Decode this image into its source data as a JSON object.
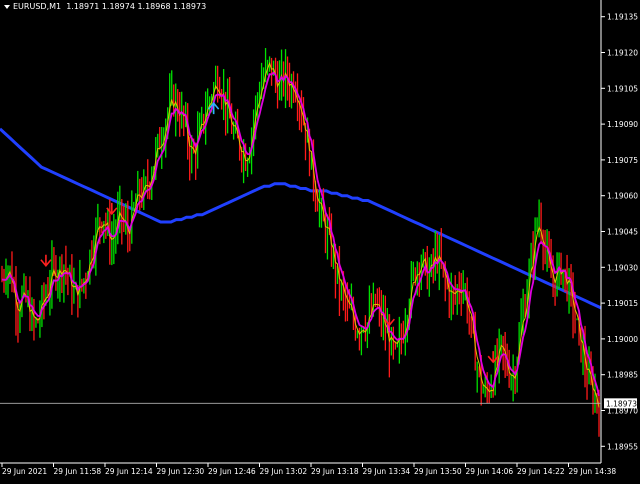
{
  "header": {
    "symbol": "EURUSD,M1",
    "ohlc": "1.18971 1.18974 1.18968 1.18973",
    "collapse_icon": "triangle-down-icon"
  },
  "colors": {
    "background": "#000000",
    "bull": "#00e000",
    "bear": "#ff1a1a",
    "ma_fast": "#e000e0",
    "ma_fast_aux": "#e0c000",
    "ma_slow": "#2040ff",
    "signal_sell": "#ff2020",
    "signal_buy": "#30b0ff",
    "axis_text": "#ffffff",
    "price_tag_bg": "#ffffff",
    "price_tag_text": "#000000"
  },
  "chart_data": {
    "type": "candlestick",
    "symbol": "EURUSD",
    "timeframe": "M1",
    "y_ticks": [
      "1.19135",
      "1.19120",
      "1.19105",
      "1.19090",
      "1.19075",
      "1.19060",
      "1.19045",
      "1.19030",
      "1.19015",
      "1.19000",
      "1.18985",
      "1.18970",
      "1.18955"
    ],
    "x_ticks": [
      "29 Jun 2021",
      "29 Jun 11:58",
      "29 Jun 12:14",
      "29 Jun 12:30",
      "29 Jun 12:46",
      "29 Jun 13:02",
      "29 Jun 13:18",
      "29 Jun 13:34",
      "29 Jun 13:50",
      "29 Jun 14:06",
      "29 Jun 14:22",
      "29 Jun 14:38"
    ],
    "ylim": [
      1.18948,
      1.19142
    ],
    "current_price": "1.18973",
    "close_series": [
      1.19025,
      1.1903,
      1.19028,
      1.1902,
      1.19012,
      1.19018,
      1.19016,
      1.1901,
      1.19005,
      1.19008,
      1.19015,
      1.1902,
      1.19025,
      1.1903,
      1.19028,
      1.19032,
      1.19028,
      1.19022,
      1.19018,
      1.1902,
      1.19024,
      1.1903,
      1.19038,
      1.19044,
      1.1905,
      1.19052,
      1.19045,
      1.1904,
      1.19046,
      1.19052,
      1.19048,
      1.19044,
      1.1905,
      1.19058,
      1.19062,
      1.1906,
      1.19066,
      1.19072,
      1.19078,
      1.19084,
      1.1909,
      1.19096,
      1.191,
      1.19098,
      1.19094,
      1.1909,
      1.1908,
      1.19076,
      1.19082,
      1.19088,
      1.19095,
      1.191,
      1.19104,
      1.1911,
      1.19106,
      1.19098,
      1.19092,
      1.19086,
      1.19082,
      1.1908,
      1.19076,
      1.19082,
      1.19092,
      1.19102,
      1.19108,
      1.19112,
      1.19115,
      1.1911,
      1.19106,
      1.19108,
      1.1911,
      1.19106,
      1.19108,
      1.19102,
      1.19094,
      1.19084,
      1.19074,
      1.19064,
      1.19056,
      1.19048,
      1.19044,
      1.19038,
      1.1903,
      1.19022,
      1.19018,
      1.19012,
      1.1901,
      1.19006,
      1.19004,
      1.19008,
      1.19006,
      1.19012,
      1.19015,
      1.1901,
      1.19006,
      1.19,
      1.18996,
      1.18992,
      1.18998,
      1.19006,
      1.19016,
      1.19024,
      1.1903,
      1.19034,
      1.1903,
      1.19026,
      1.1903,
      1.19036,
      1.1903,
      1.19024,
      1.1902,
      1.19016,
      1.1902,
      1.19024,
      1.1902,
      1.1901,
      1.18998,
      1.18988,
      1.1898,
      1.18976,
      1.1898,
      1.18984,
      1.18992,
      1.18996,
      1.1899,
      1.18986,
      1.18984,
      1.18996,
      1.19008,
      1.19018,
      1.19028,
      1.1904,
      1.19052,
      1.19046,
      1.19034,
      1.19026,
      1.19024,
      1.19028,
      1.1903,
      1.19024,
      1.19018,
      1.1901,
      1.19,
      1.18994,
      1.18985,
      1.1898,
      1.18976,
      1.18973
    ],
    "ma_slow_series": [
      1.19088,
      1.19086,
      1.19084,
      1.19082,
      1.1908,
      1.19078,
      1.19076,
      1.19074,
      1.19072,
      1.19071,
      1.1907,
      1.19069,
      1.19068,
      1.19067,
      1.19066,
      1.19065,
      1.19064,
      1.19063,
      1.19062,
      1.19061,
      1.1906,
      1.19059,
      1.19058,
      1.19057,
      1.19056,
      1.19055,
      1.19054,
      1.19053,
      1.19052,
      1.19051,
      1.1905,
      1.19049,
      1.19049,
      1.19049,
      1.1905,
      1.1905,
      1.19051,
      1.19051,
      1.19052,
      1.19052,
      1.19053,
      1.19054,
      1.19055,
      1.19056,
      1.19057,
      1.19058,
      1.19059,
      1.1906,
      1.19061,
      1.19062,
      1.19063,
      1.19064,
      1.19064,
      1.19065,
      1.19065,
      1.19065,
      1.19064,
      1.19064,
      1.19063,
      1.19063,
      1.19062,
      1.19062,
      1.19062,
      1.19062,
      1.19061,
      1.19061,
      1.1906,
      1.1906,
      1.19059,
      1.19059,
      1.19058,
      1.19058,
      1.19057,
      1.19056,
      1.19055,
      1.19054,
      1.19053,
      1.19052,
      1.19051,
      1.1905,
      1.19049,
      1.19048,
      1.19047,
      1.19046,
      1.19045,
      1.19044,
      1.19043,
      1.19042,
      1.19041,
      1.1904,
      1.19039,
      1.19038,
      1.19037,
      1.19036,
      1.19035,
      1.19034,
      1.19033,
      1.19032,
      1.19031,
      1.1903,
      1.19029,
      1.19028,
      1.19027,
      1.19026,
      1.19025,
      1.19024,
      1.19023,
      1.19022,
      1.19021,
      1.1902,
      1.19019,
      1.19018,
      1.19017,
      1.19016,
      1.19015,
      1.19014,
      1.19013
    ],
    "signals": [
      {
        "dir": "sell",
        "index": 22
      },
      {
        "dir": "sell",
        "index": 55
      },
      {
        "dir": "buy",
        "index": 106
      },
      {
        "dir": "sell",
        "index": 194
      },
      {
        "dir": "sell",
        "index": 246
      }
    ]
  }
}
